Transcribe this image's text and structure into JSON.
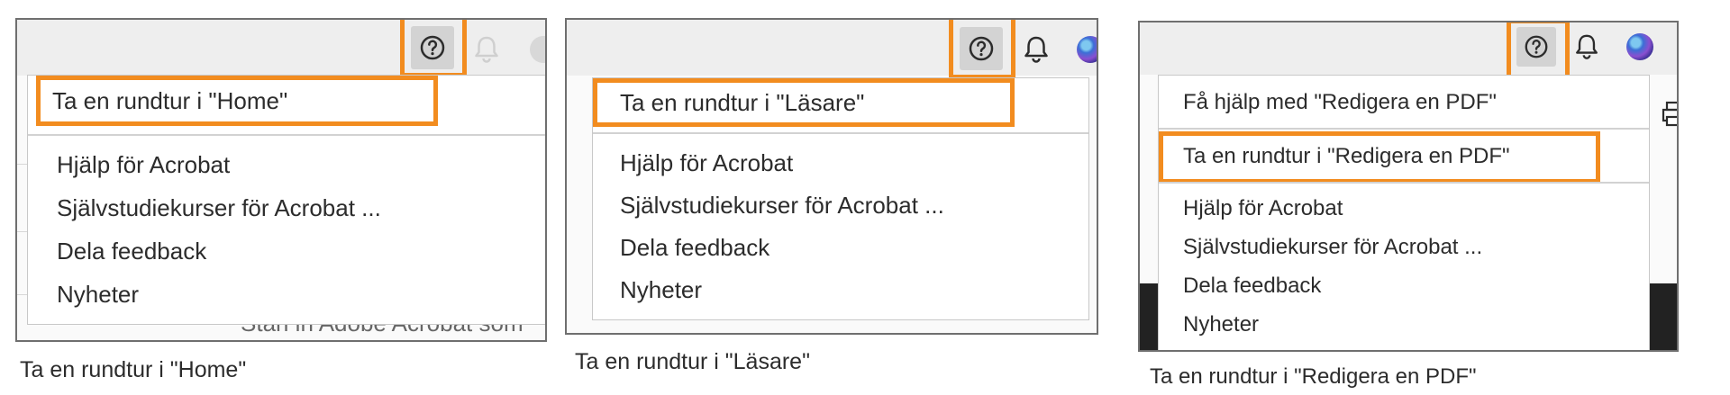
{
  "panel1": {
    "menu": {
      "tour": "Ta en rundtur i \"Home\"",
      "help": "Hjälp för Acrobat",
      "tutorials": "Självstudiekurser för Acrobat ...",
      "feedback": "Dela feedback",
      "news": "Nyheter"
    },
    "background_text": "Starl in Adobe Acrobat som",
    "caption": "Ta en rundtur i \"Home\""
  },
  "panel2": {
    "menu": {
      "tour": "Ta en rundtur i \"Läsare\"",
      "help": "Hjälp för Acrobat",
      "tutorials": "Självstudiekurser för Acrobat ...",
      "feedback": "Dela feedback",
      "news": "Nyheter"
    },
    "caption": "Ta en rundtur i \"Läsare\""
  },
  "panel3": {
    "menu": {
      "get_help": "Få hjälp med \"Redigera en PDF\"",
      "tour": "Ta en rundtur i \"Redigera en PDF\"",
      "help": "Hjälp för Acrobat",
      "tutorials": "Självstudiekurser för Acrobat ...",
      "feedback": "Dela feedback",
      "news": "Nyheter"
    },
    "caption": "Ta en rundtur i \"Redigera en PDF\""
  },
  "colors": {
    "highlight": "#f28c1f",
    "topbar": "#eeeeee",
    "help_button": "#d3d3d3"
  },
  "icons": [
    "help-circle-icon",
    "bell-icon",
    "avatar-icon",
    "print-icon"
  ]
}
